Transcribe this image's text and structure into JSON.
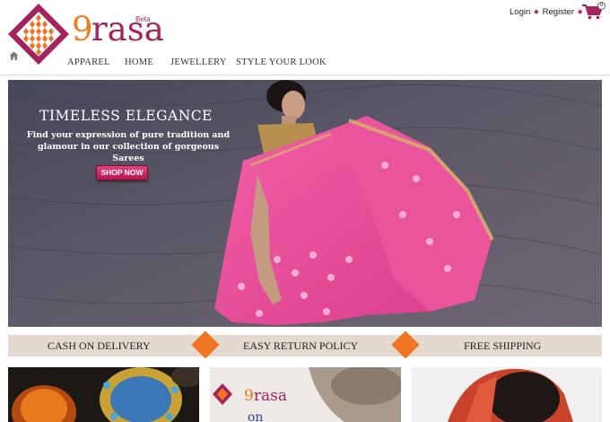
{
  "brand": {
    "nine": "9",
    "rasa": "rasa",
    "beta": "Beta",
    "color_nine": "#f07a1e",
    "color_rasa": "#a3235f"
  },
  "header": {
    "login": "Login",
    "register": "Register",
    "cart_count": "0"
  },
  "nav": [
    "APPAREL",
    "HOME",
    "JEWELLERY",
    "STYLE YOUR LOOK"
  ],
  "hero": {
    "title": "TIMELESS ELEGANCE",
    "subtitle_line1": "Find your expression of pure tradition and",
    "subtitle_line2": "glamour in our collection of gorgeous Sarees",
    "cta": "SHOP NOW"
  },
  "benefits": [
    "CASH ON DELIVERY",
    "EASY RETURN POLICY",
    "FREE SHIPPING"
  ],
  "thumbs": {
    "t2_brand_nine": "9",
    "t2_brand_rasa": "rasa",
    "t2_word": "on"
  },
  "icons": {
    "home": "home-icon",
    "cart": "cart-icon",
    "logo": "logo-icon"
  },
  "colors": {
    "accent": "#a3235f",
    "orange": "#ef7524",
    "strip": "#e3d9cf",
    "button": "#c71f5a"
  }
}
